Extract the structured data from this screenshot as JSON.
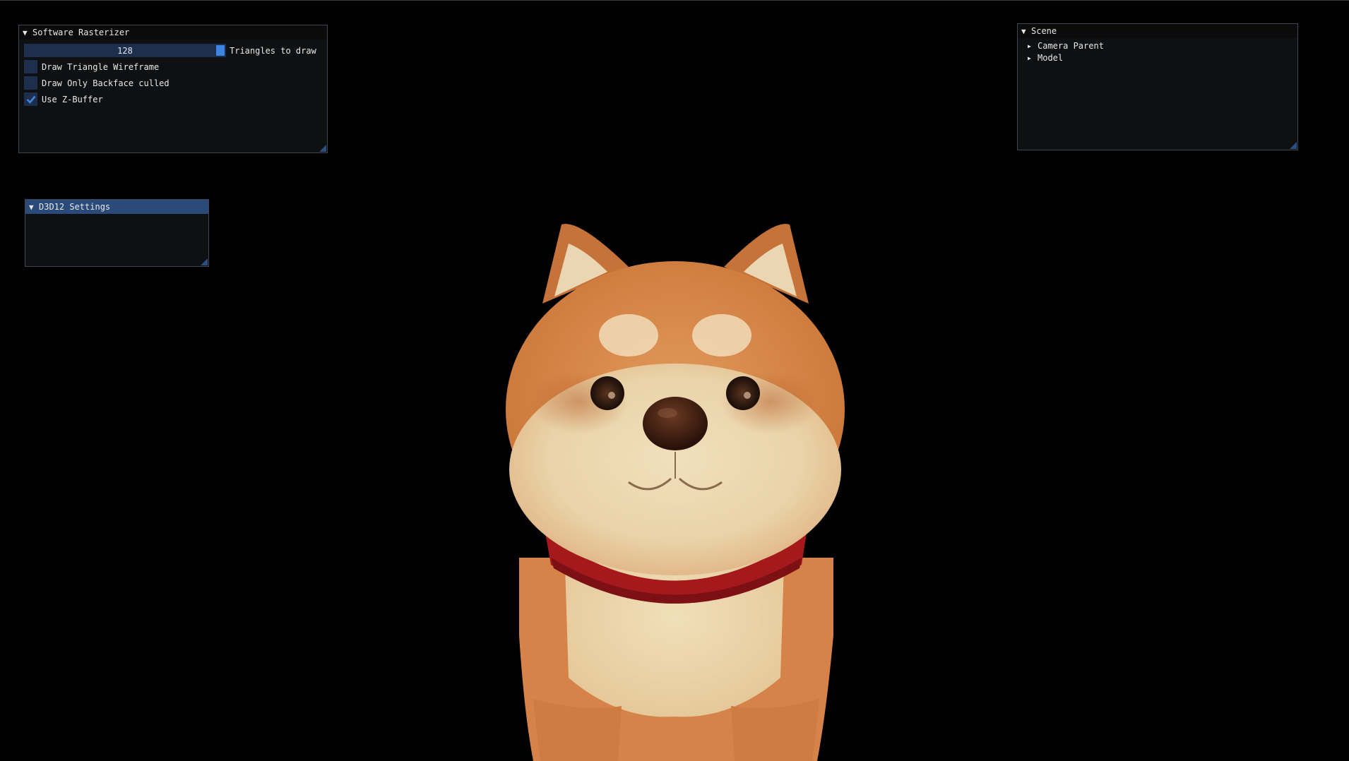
{
  "software_rasterizer": {
    "title": "Software Rasterizer",
    "triangles_slider": {
      "value": "128",
      "label": "Triangles to draw",
      "fill_fraction": 1.0
    },
    "checkboxes": [
      {
        "label": "Draw Triangle Wireframe",
        "checked": false
      },
      {
        "label": "Draw Only Backface culled",
        "checked": false
      },
      {
        "label": "Use Z-Buffer",
        "checked": true
      }
    ]
  },
  "d3d12_settings": {
    "title": "D3D12 Settings"
  },
  "scene": {
    "title": "Scene",
    "items": [
      {
        "label": "Camera Parent"
      },
      {
        "label": "Model"
      }
    ]
  },
  "colors": {
    "window_bg": "#0f1011",
    "frame_bg": "#1d2f4d",
    "accent": "#3d85e0",
    "title_active": "#2a4a7a",
    "dog_fur": "#d9864a",
    "dog_cream": "#ecd8b0",
    "collar": "#a5191c"
  },
  "icons": {
    "collapse": "triangle-down-icon",
    "tree_node": "triangle-right-icon",
    "check": "check-icon"
  }
}
